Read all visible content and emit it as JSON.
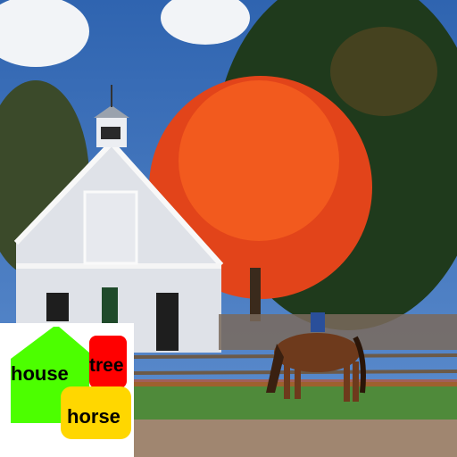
{
  "scene": {
    "description_labels": [
      "house",
      "tree",
      "horse"
    ]
  },
  "inset": {
    "labels": {
      "house": "house",
      "tree": "tree",
      "horse": "horse"
    },
    "colors": {
      "house": "#4cff00",
      "tree": "#ff0000",
      "horse": "#ffd700",
      "background": "#ffffff"
    }
  }
}
